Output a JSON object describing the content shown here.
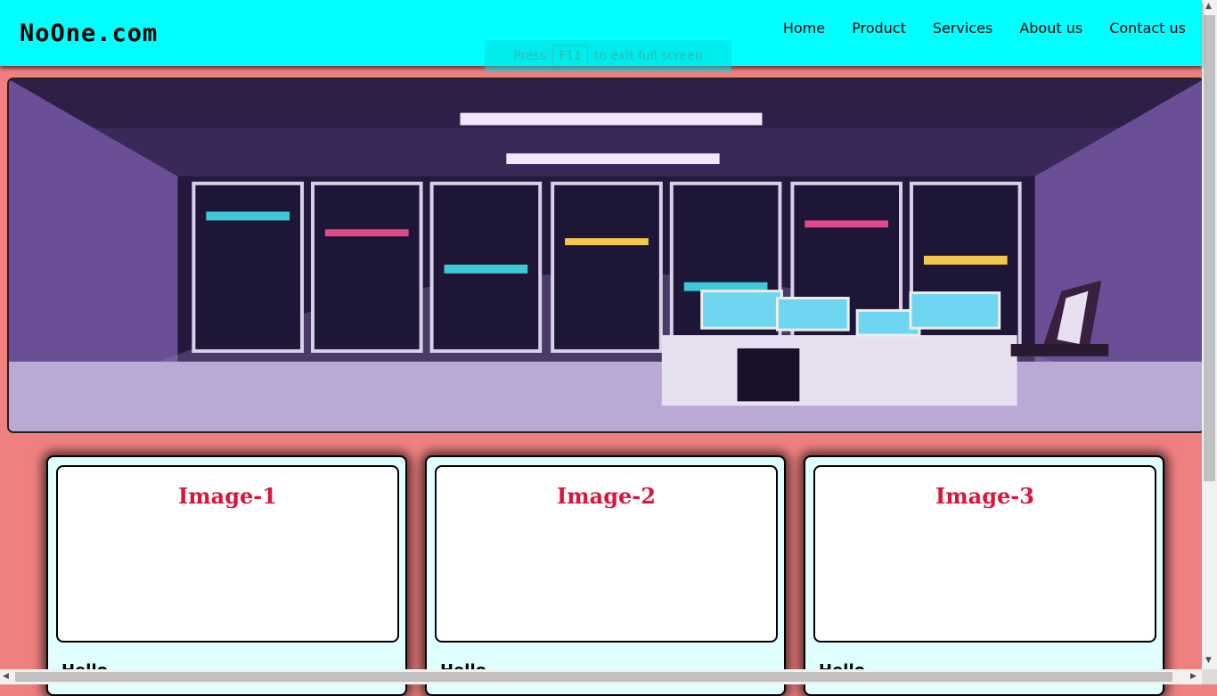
{
  "header": {
    "brand": "NoOne.com",
    "nav": [
      "Home",
      "Product",
      "Services",
      "About us",
      "Contact us"
    ]
  },
  "fullscreen_toast": {
    "prefix": "Press",
    "key": "F11",
    "suffix": "to exit full screen"
  },
  "cards": [
    {
      "title": "Image-1",
      "text": "Hello"
    },
    {
      "title": "Image-2",
      "text": "Hello"
    },
    {
      "title": "Image-3",
      "text": "Hello"
    }
  ],
  "colors": {
    "header_bg": "#00ffff",
    "page_bg": "#f08080",
    "card_bg": "#e0ffff",
    "card_title": "#dc143c"
  },
  "icons": [
    "scroll-up-arrow-icon",
    "scroll-down-arrow-icon",
    "scroll-left-arrow-icon",
    "scroll-right-arrow-icon"
  ]
}
